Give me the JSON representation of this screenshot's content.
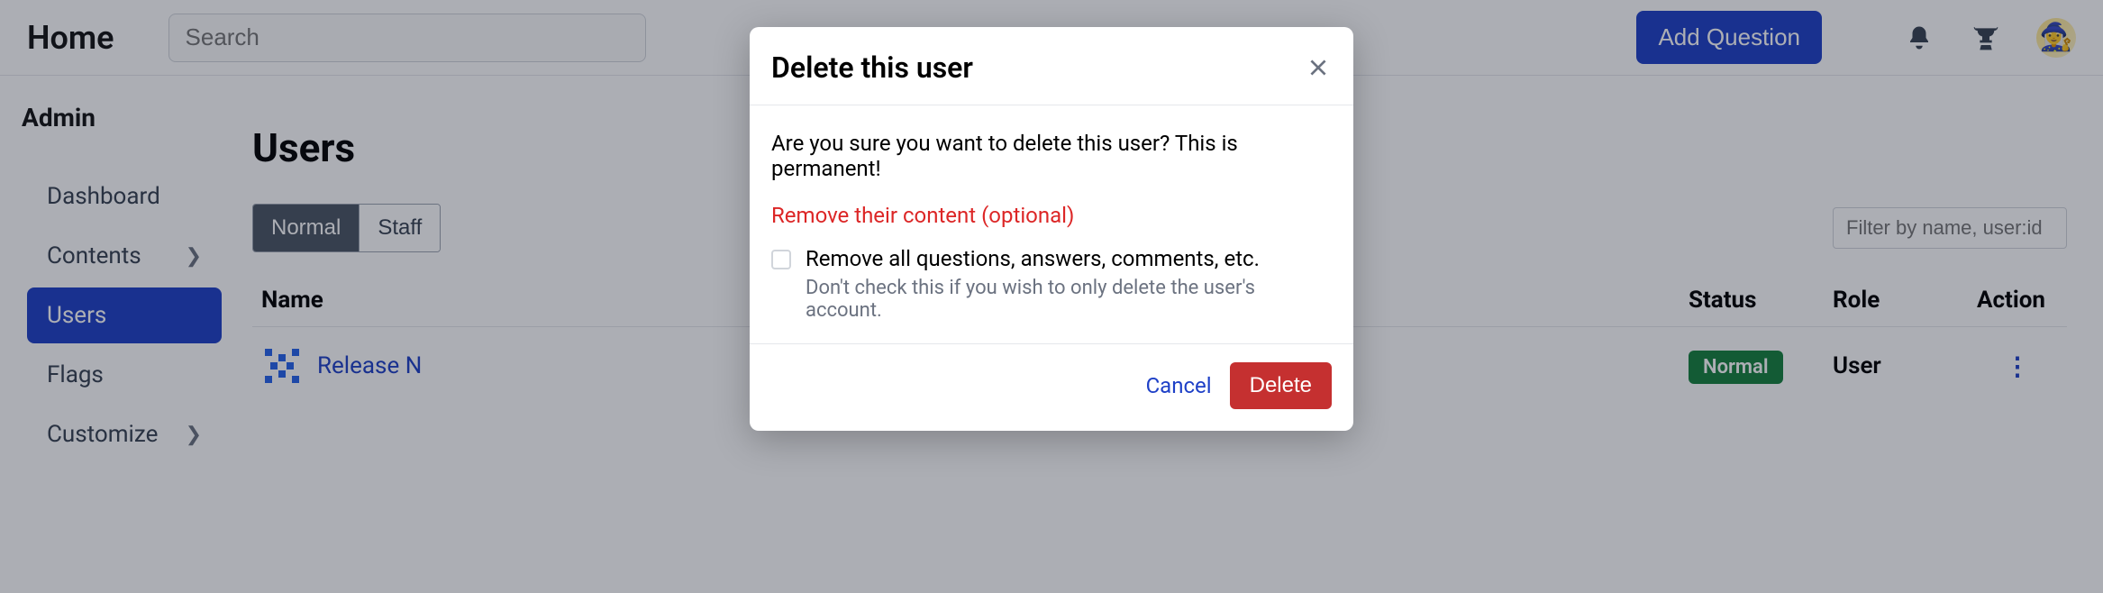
{
  "topbar": {
    "home_label": "Home",
    "search_placeholder": "Search",
    "add_question_label": "Add Question"
  },
  "sidebar": {
    "heading": "Admin",
    "items": [
      {
        "label": "Dashboard",
        "has_children": false
      },
      {
        "label": "Contents",
        "has_children": true
      },
      {
        "label": "Users",
        "has_children": false,
        "active": true
      },
      {
        "label": "Flags",
        "has_children": false
      },
      {
        "label": "Customize",
        "has_children": true
      }
    ]
  },
  "main": {
    "title": "Users",
    "tabs": {
      "normal": "Normal",
      "staff": "Staff"
    },
    "filter_placeholder": "Filter by name, user:id",
    "columns": {
      "name": "Name",
      "status": "Status",
      "role": "Role",
      "action": "Action"
    },
    "rows": [
      {
        "name": "Release N",
        "status": "Normal",
        "role": "User"
      }
    ]
  },
  "modal": {
    "title": "Delete this user",
    "confirm_text": "Are you sure you want to delete this user? This is permanent!",
    "remove_heading": "Remove their content (optional)",
    "checkbox_label": "Remove all questions, answers, comments, etc.",
    "checkbox_hint": "Don't check this if you wish to only delete the user's account.",
    "cancel_label": "Cancel",
    "delete_label": "Delete"
  }
}
